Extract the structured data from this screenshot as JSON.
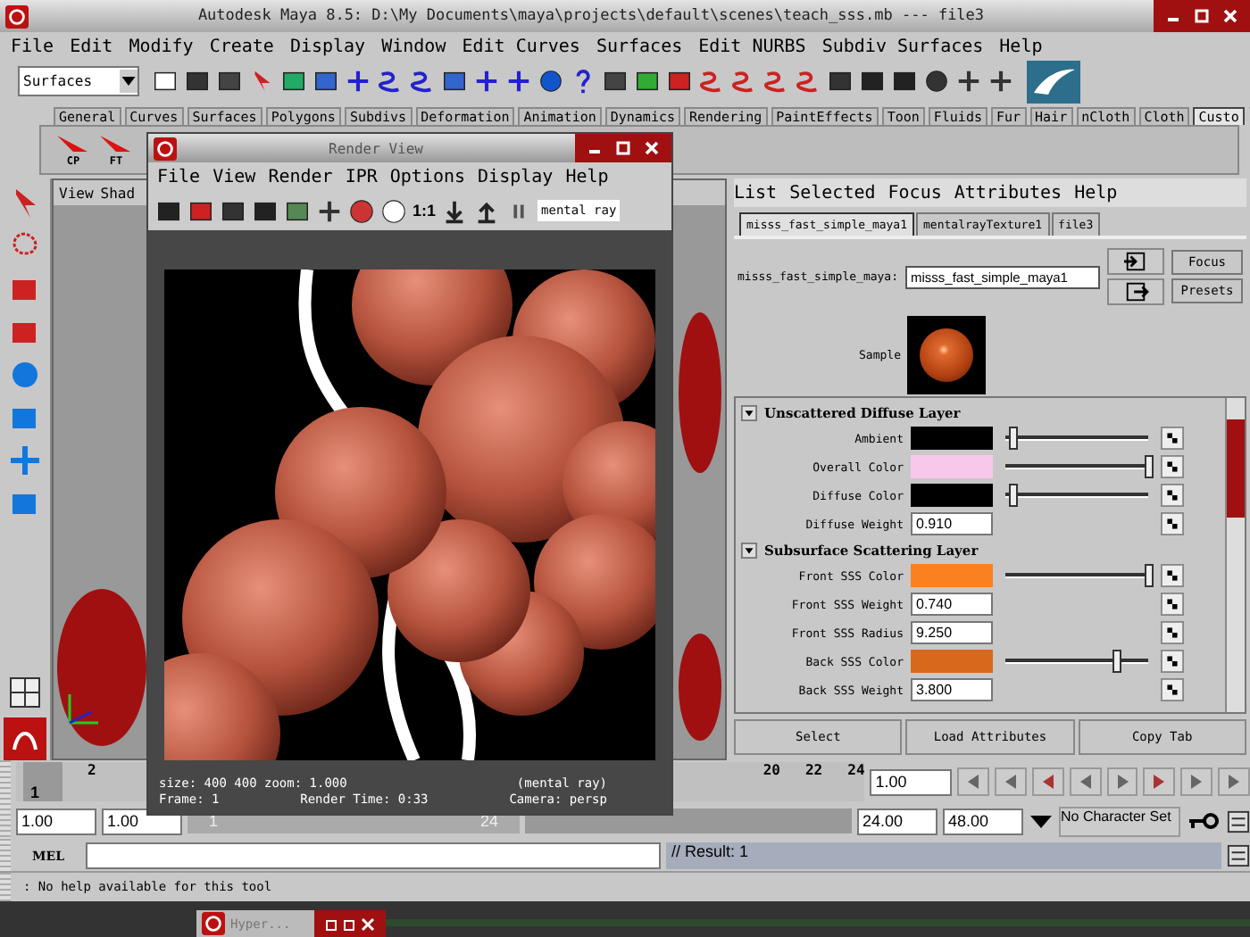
{
  "window": {
    "title": "Autodesk Maya 8.5: D:\\My Documents\\maya\\projects\\default\\scenes\\teach_sss.mb  ---  file3"
  },
  "menu": [
    "File",
    "Edit",
    "Modify",
    "Create",
    "Display",
    "Window",
    "Edit Curves",
    "Surfaces",
    "Edit NURBS",
    "Subdiv Surfaces",
    "Help"
  ],
  "toolbar": {
    "mode_dropdown": "Surfaces"
  },
  "shelf_tabs": [
    {
      "label": "General",
      "selected": false
    },
    {
      "label": "Curves",
      "selected": false
    },
    {
      "label": "Surfaces",
      "selected": false
    },
    {
      "label": "Polygons",
      "selected": false
    },
    {
      "label": "Subdivs",
      "selected": false
    },
    {
      "label": "Deformation",
      "selected": false
    },
    {
      "label": "Animation",
      "selected": false
    },
    {
      "label": "Dynamics",
      "selected": false
    },
    {
      "label": "Rendering",
      "selected": false
    },
    {
      "label": "PaintEffects",
      "selected": false
    },
    {
      "label": "Toon",
      "selected": false
    },
    {
      "label": "Fluids",
      "selected": false
    },
    {
      "label": "Fur",
      "selected": false
    },
    {
      "label": "Hair",
      "selected": false
    },
    {
      "label": "nCloth",
      "selected": false
    },
    {
      "label": "Cloth",
      "selected": false
    },
    {
      "label": "Custo",
      "selected": true
    }
  ],
  "shelf_buttons": [
    "CP",
    "FT"
  ],
  "viewport": {
    "menu": [
      "View",
      "Shad"
    ]
  },
  "render_view": {
    "title": "Render View",
    "menu": [
      "File",
      "View",
      "Render",
      "IPR",
      "Options",
      "Display",
      "Help"
    ],
    "zoom_label": "1:1",
    "renderer_field": "mental ray",
    "info": {
      "size": "size:  400  400 zoom: 1.000",
      "renderer": "(mental ray)",
      "frame": "Frame: 1",
      "render_time": "Render Time: 0:33",
      "camera": "Camera: persp"
    }
  },
  "attribute_editor": {
    "menu": [
      "List",
      "Selected",
      "Focus",
      "Attributes",
      "Help"
    ],
    "tabs": [
      {
        "label": "misss_fast_simple_maya1",
        "selected": true
      },
      {
        "label": "mentalrayTexture1",
        "selected": false
      },
      {
        "label": "file3",
        "selected": false
      }
    ],
    "node_label": "misss_fast_simple_maya:",
    "node_name": "misss_fast_simple_maya1",
    "buttons": [
      "Focus",
      "Presets"
    ],
    "sample_label": "Sample",
    "sections": [
      {
        "title": "Unscattered Diffuse Layer",
        "expanded": true,
        "rows": [
          {
            "kind": "color",
            "label": "Ambient",
            "color": "#000000",
            "level": 0.05
          },
          {
            "kind": "color",
            "label": "Overall Color",
            "color": "#f8c8ec",
            "level": 1.0
          },
          {
            "kind": "color",
            "label": "Diffuse Color",
            "color": "#000000",
            "level": 0.05
          },
          {
            "kind": "number",
            "label": "Diffuse Weight",
            "value": "0.910"
          }
        ]
      },
      {
        "title": "Subsurface Scattering Layer",
        "expanded": true,
        "rows": [
          {
            "kind": "color",
            "label": "Front SSS Color",
            "color": "#fa8020",
            "level": 1.0
          },
          {
            "kind": "number",
            "label": "Front SSS Weight",
            "value": "0.740"
          },
          {
            "kind": "number",
            "label": "Front SSS Radius",
            "value": "9.250"
          },
          {
            "kind": "color",
            "label": "Back SSS Color",
            "color": "#d8681c",
            "level": 0.78
          },
          {
            "kind": "number",
            "label": "Back SSS Weight",
            "value": "3.800"
          }
        ]
      }
    ],
    "action_buttons": [
      "Select",
      "Load Attributes",
      "Copy Tab"
    ]
  },
  "timeline": {
    "current_frame": "1",
    "labels": [
      "2",
      "20",
      "22",
      "24"
    ],
    "current_time": "1.00"
  },
  "range": {
    "start": "1.00",
    "playback_start": "1.00",
    "slider_start": "1",
    "slider_end": "24",
    "playback_end": "24.00",
    "end": "48.00",
    "character_set": "No Character Set"
  },
  "command_line": {
    "label": "MEL",
    "result": "// Result: 1"
  },
  "help_line": ": No help available for this tool",
  "taskbar": [
    {
      "label": "Hyper..."
    }
  ]
}
